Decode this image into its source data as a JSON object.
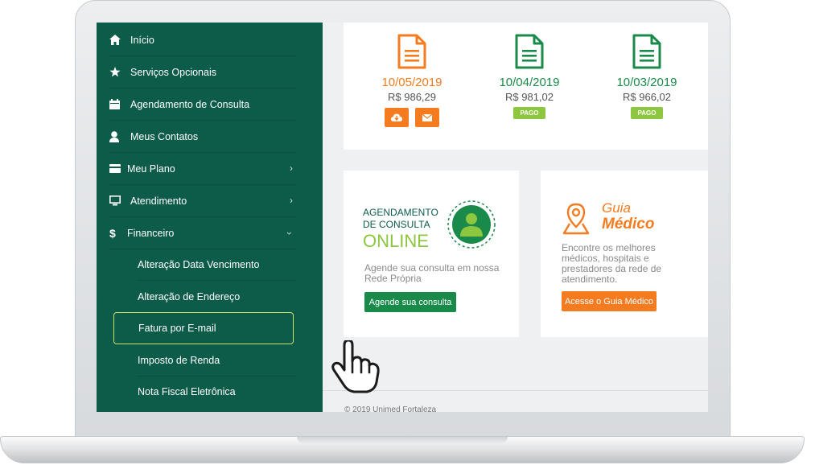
{
  "sidebar": {
    "items": [
      {
        "label": "Início",
        "icon": "home-icon"
      },
      {
        "label": "Serviços Opcionais",
        "icon": "star-icon"
      },
      {
        "label": "Agendamento de Consulta",
        "icon": "calendar-icon"
      },
      {
        "label": "Meus Contatos",
        "icon": "user-icon"
      },
      {
        "label": "Meu Plano",
        "icon": "card-icon"
      },
      {
        "label": "Atendimento",
        "icon": "monitor-icon"
      },
      {
        "label": "Financeiro",
        "icon": "dollar-icon"
      }
    ],
    "financeiro_sub": [
      {
        "label": "Alteração Data Vencimento"
      },
      {
        "label": "Alteração de Endereço"
      },
      {
        "label": "Fatura por E-mail",
        "active": true
      },
      {
        "label": "Imposto de Renda"
      },
      {
        "label": "Nota Fiscal Eletrônica"
      }
    ]
  },
  "invoices": [
    {
      "date": "10/05/2019",
      "amount": "R$ 986,29",
      "status": "",
      "color": "#f47b20"
    },
    {
      "date": "10/04/2019",
      "amount": "R$ 981,02",
      "status": "PAGO",
      "color": "#1a8a4a"
    },
    {
      "date": "10/03/2019",
      "amount": "R$ 966,02",
      "status": "PAGO",
      "color": "#1a8a4a"
    }
  ],
  "agendamento": {
    "title_line1": "AGENDAMENTO",
    "title_line2": "DE CONSULTA",
    "title_line3": "ONLINE",
    "text": "Agende sua consulta em nossa Rede Própria",
    "button": "Agende sua consulta"
  },
  "guia": {
    "title_line1": "Guia",
    "title_line2": "Médico",
    "text": "Encontre os melhores médicos, hospitais e prestadores da rede de atendimento.",
    "button": "Acesse o Guia Médico"
  },
  "footer": {
    "text": "© 2019 Unimed Fortaleza"
  },
  "colors": {
    "sidebar": "#0d5c4a",
    "orange": "#f47b20",
    "green": "#1a8a4a",
    "paid": "#8dc63f",
    "lime": "#8dc63f"
  }
}
